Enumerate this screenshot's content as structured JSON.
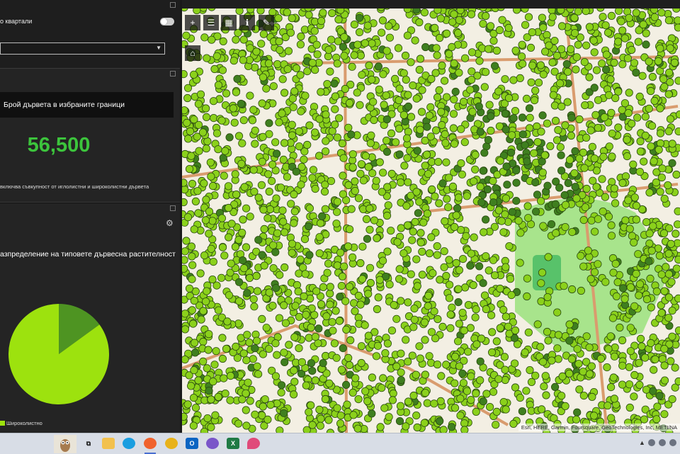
{
  "filter_panel": {
    "toggle_label": "о квартали",
    "select_value": ""
  },
  "count_panel": {
    "title": "Брой дървета в избраните граници",
    "value": "56,500",
    "description": "включва съвкупност от иглолистни и широколистни дървета"
  },
  "chart_panel": {
    "title": "азпределение на типовете дървесна растителност"
  },
  "chart_data": {
    "type": "pie",
    "slices": [
      {
        "label": "Широколистно",
        "value": 85,
        "color": "#9de20e"
      },
      {
        "label": "",
        "value": 15,
        "color": "#4e9422"
      }
    ],
    "legend": [
      "Широколистно"
    ],
    "legend_position": "bottom-left"
  },
  "map": {
    "attribution": "Esri, HERE, Garmin, Foursquare, GeoTechnologies, Inc, METI/NA",
    "tree_color_broadleaf": "#8bd11b",
    "tree_color_conifer": "#3f7f1f",
    "base_color": "#f3efe3",
    "park_color": "#a8e48c"
  },
  "map_toolbar": {
    "icons": [
      "zoom-in-icon",
      "layer-list-icon",
      "basemap-gallery-icon",
      "info-icon",
      "edit-icon"
    ],
    "home_icon": "home-icon"
  },
  "taskbar": {
    "apps": [
      "task-view-icon",
      "file-explorer-icon",
      "edge-icon",
      "firefox-icon",
      "chrome-icon",
      "outlook-icon",
      "viber-icon",
      "excel-icon",
      "paint-icon"
    ]
  }
}
